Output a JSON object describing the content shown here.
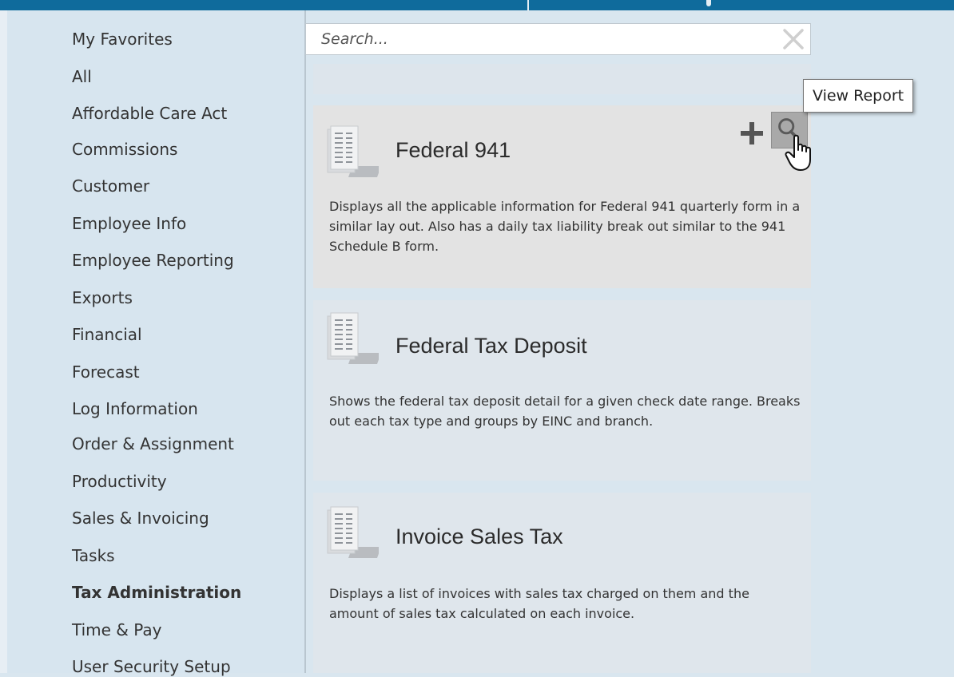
{
  "sidebar": {
    "categories": [
      {
        "label": "My Favorites"
      },
      {
        "label": "All"
      },
      {
        "label": "Affordable Care Act"
      },
      {
        "label": "Commissions"
      },
      {
        "label": "Customer"
      },
      {
        "label": "Employee Info"
      },
      {
        "label": "Employee Reporting"
      },
      {
        "label": "Exports"
      },
      {
        "label": "Financial"
      },
      {
        "label": "Forecast"
      },
      {
        "label": "Log Information"
      },
      {
        "label": "Order & Assignment"
      },
      {
        "label": "Productivity"
      },
      {
        "label": "Sales & Invoicing"
      },
      {
        "label": "Tasks"
      },
      {
        "label": "Tax Administration"
      },
      {
        "label": "Time & Pay"
      },
      {
        "label": "User Security Setup"
      }
    ],
    "selected": "Tax Administration"
  },
  "search": {
    "placeholder": "Search...",
    "value": ""
  },
  "reports": [
    {
      "title": "Federal 941",
      "description": "Displays all the applicable information for Federal 941 quarterly form in a similar lay out.  Also has a daily tax liability break out similar to the 941 Schedule B form."
    },
    {
      "title": "Federal Tax Deposit",
      "description": "Shows the federal tax deposit detail for a given check date range. Breaks out each tax type and groups by EINC and branch."
    },
    {
      "title": "Invoice Sales Tax",
      "description": "Displays a list of invoices with sales tax charged on them and the amount of sales tax calculated on each invoice."
    }
  ],
  "actions": {
    "add_icon": "plus-icon",
    "view_icon": "magnifier-icon"
  },
  "tooltip": {
    "text": "View Report"
  },
  "colors": {
    "header": "#0f6b9c",
    "sidebar_bg": "#d7e5ef",
    "card_bg": "#dfe6ec",
    "card_hover_bg": "#e3e3e3",
    "view_button": "#a9a9a9"
  }
}
